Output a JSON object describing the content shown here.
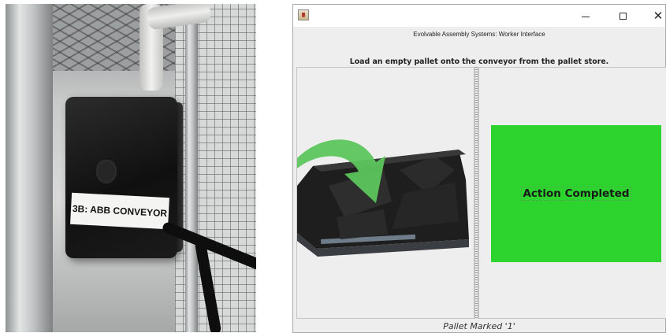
{
  "photo": {
    "device_label": "3B: ABB CONVEYOR"
  },
  "window": {
    "app_icon": "java-cup-icon",
    "controls": {
      "minimize": "minimize-icon",
      "maximize": "maximize-icon",
      "close": "close-icon"
    },
    "title": "Evolvable Assembly Systems: Worker Interface",
    "instruction": "Load an empty pallet onto the conveyor from the pallet store.",
    "status": {
      "text": "Action Completed",
      "color": "#2DD42D"
    },
    "footer": "Pallet Marked '1'"
  },
  "colors": {
    "arrow": "#5CC65C",
    "status_green": "#2DD42D",
    "window_bg": "#EEEEEE"
  }
}
